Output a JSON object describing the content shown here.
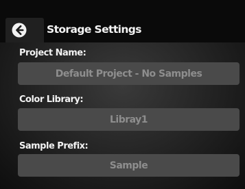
{
  "header": {
    "title": "Storage Settings",
    "back_icon": "circle-arrow-left-icon"
  },
  "fields": [
    {
      "label": "Project Name:",
      "value": "Default Project - No Samples"
    },
    {
      "label": "Color Library:",
      "value": "Libray1"
    },
    {
      "label": "Sample Prefix:",
      "value": "Sample"
    }
  ],
  "colors": {
    "header_background": "#0a0a0a",
    "field_background": "#4a4a4a",
    "field_text": "#8e8e8e",
    "label_text": "#f2f2f2"
  }
}
